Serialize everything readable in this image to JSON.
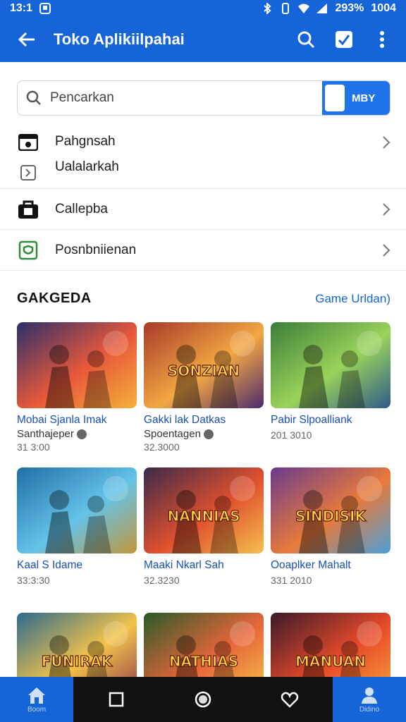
{
  "status_bar": {
    "time": "13:1",
    "battery": "293%",
    "clock": "1004"
  },
  "app_bar": {
    "title": "Toko Aplikiilpahai"
  },
  "search": {
    "placeholder": "Pencarkan",
    "button_label": "MBY"
  },
  "menu": {
    "items": [
      {
        "label": "Pahgnsah",
        "sub_label": "Ualalarkah",
        "icon": "media-icon"
      },
      {
        "label": "Callepba",
        "icon": "bag-icon"
      },
      {
        "label": "Posnbniienan",
        "icon": "shield-icon"
      }
    ]
  },
  "section": {
    "title": "GAKGEDA",
    "link": "Game Urldan)"
  },
  "games": [
    {
      "title": "Mobai Sjanla Imak",
      "sub": "Santhajeper",
      "meta": "31 3:00",
      "colors": [
        "#2b2f6b",
        "#e8583a",
        "#f4b13a"
      ]
    },
    {
      "title": "Gakki lak Datkas",
      "sub": "Spoentagen",
      "meta": "32.3000",
      "colors": [
        "#a63a2a",
        "#f3a743",
        "#4b2a6e"
      ],
      "banner": "SONZIAN"
    },
    {
      "title": "Pabir Slpoalliank",
      "sub": "",
      "meta": "201 3010",
      "colors": [
        "#3c7d3a",
        "#9ad35a",
        "#2e5a8a"
      ]
    },
    {
      "title": "Kaal S Idame",
      "sub": "",
      "meta": "33:3:30",
      "colors": [
        "#1f6fa6",
        "#64c3e8",
        "#c3963b"
      ]
    },
    {
      "title": "Maaki Nkarl Sah",
      "sub": "",
      "meta": "32.3230",
      "colors": [
        "#3a2a4a",
        "#e0502e",
        "#f4c04e"
      ],
      "banner": "NANNIAS"
    },
    {
      "title": "Ooaplker Mahalt",
      "sub": "",
      "meta": "331 2010",
      "colors": [
        "#6a3a8e",
        "#e87a3a",
        "#4aa0d8"
      ],
      "banner": "SINDISIK"
    },
    {
      "title": "",
      "sub": "",
      "meta": "",
      "colors": [
        "#2d6a8e",
        "#f3c34a",
        "#8e3a4a"
      ],
      "banner": "FUNIRAK"
    },
    {
      "title": "",
      "sub": "",
      "meta": "",
      "colors": [
        "#2a5a2a",
        "#e8663a",
        "#f4c44a"
      ],
      "banner": "NATHIAS"
    },
    {
      "title": "",
      "sub": "",
      "meta": "",
      "colors": [
        "#3a1a2a",
        "#e84a2a",
        "#f4a43a"
      ],
      "banner": "MANUAN"
    }
  ],
  "bottom_nav": {
    "home_label": "Boom",
    "profile_label": "Didino"
  }
}
